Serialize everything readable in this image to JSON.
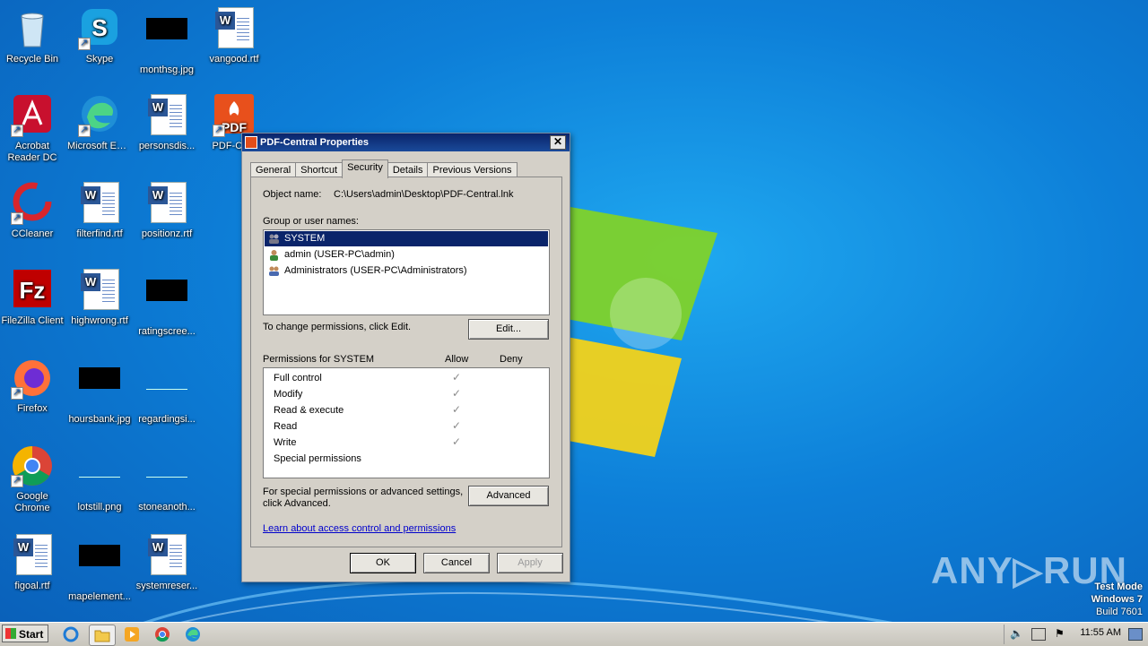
{
  "desktop": {
    "icons": [
      {
        "label": "Recycle Bin",
        "icon": "recycle-bin-icon"
      },
      {
        "label": "Skype",
        "icon": "skype-icon"
      },
      {
        "label": "monthsg.jpg",
        "icon": "image-file-icon"
      },
      {
        "label": "vangood.rtf",
        "icon": "word-document-icon"
      },
      {
        "label": "Acrobat Reader DC",
        "icon": "acrobat-icon"
      },
      {
        "label": "Microsoft Edge",
        "icon": "edge-icon"
      },
      {
        "label": "personsdis...",
        "icon": "word-document-icon"
      },
      {
        "label": "PDF-Ce...",
        "icon": "pdf-central-icon"
      },
      {
        "label": "CCleaner",
        "icon": "ccleaner-icon"
      },
      {
        "label": "filterfind.rtf",
        "icon": "word-document-icon"
      },
      {
        "label": "positionz.rtf",
        "icon": "word-document-icon"
      },
      {
        "label": "FileZilla Client",
        "icon": "filezilla-icon"
      },
      {
        "label": "highwrong.rtf",
        "icon": "word-document-icon"
      },
      {
        "label": "ratingscree...",
        "icon": "image-file-icon"
      },
      {
        "label": "Firefox",
        "icon": "firefox-icon"
      },
      {
        "label": "hoursbank.jpg",
        "icon": "image-file-icon"
      },
      {
        "label": "regardingsi...",
        "icon": "image-file-icon"
      },
      {
        "label": "Google Chrome",
        "icon": "chrome-icon"
      },
      {
        "label": "lotstill.png",
        "icon": "image-file-icon"
      },
      {
        "label": "stoneanoth...",
        "icon": "image-file-icon"
      },
      {
        "label": "figoal.rtf",
        "icon": "word-document-icon"
      },
      {
        "label": "mapelement...",
        "icon": "image-file-icon"
      },
      {
        "label": "systemreser...",
        "icon": "word-document-icon"
      }
    ]
  },
  "dialog": {
    "title": "PDF-Central Properties",
    "close": "✕",
    "tabs": [
      "General",
      "Shortcut",
      "Security",
      "Details",
      "Previous Versions"
    ],
    "active_tab": "Security",
    "object_name_label": "Object name:",
    "object_name_value": "C:\\Users\\admin\\Desktop\\PDF-Central.lnk",
    "group_label": "Group or user names:",
    "groups": [
      "SYSTEM",
      "admin (USER-PC\\admin)",
      "Administrators (USER-PC\\Administrators)"
    ],
    "selected_group": "SYSTEM",
    "change_text": "To change permissions, click Edit.",
    "edit_button": "Edit...",
    "permissions_label": "Permissions for SYSTEM",
    "allow_header": "Allow",
    "deny_header": "Deny",
    "permissions": [
      {
        "name": "Full control",
        "allow": true,
        "deny": false
      },
      {
        "name": "Modify",
        "allow": true,
        "deny": false
      },
      {
        "name": "Read & execute",
        "allow": true,
        "deny": false
      },
      {
        "name": "Read",
        "allow": true,
        "deny": false
      },
      {
        "name": "Write",
        "allow": true,
        "deny": false
      },
      {
        "name": "Special permissions",
        "allow": false,
        "deny": false
      }
    ],
    "special_text_1": "For special permissions or advanced settings,",
    "special_text_2": "click Advanced.",
    "advanced_button": "Advanced",
    "learn_link": "Learn about access control and permissions",
    "ok_button": "OK",
    "cancel_button": "Cancel",
    "apply_button": "Apply"
  },
  "taskbar": {
    "start_label": "Start",
    "clock": "11:55 AM"
  },
  "watermark": "ANY▷RUN",
  "test_mode": {
    "line1": "Test Mode",
    "line2": "Windows 7",
    "line3": "Build 7601"
  },
  "colors": {
    "title_bar": "#0a246a",
    "selection": "#0a246a",
    "dialog_bg": "#d4d0c8",
    "link": "#0000cc"
  }
}
